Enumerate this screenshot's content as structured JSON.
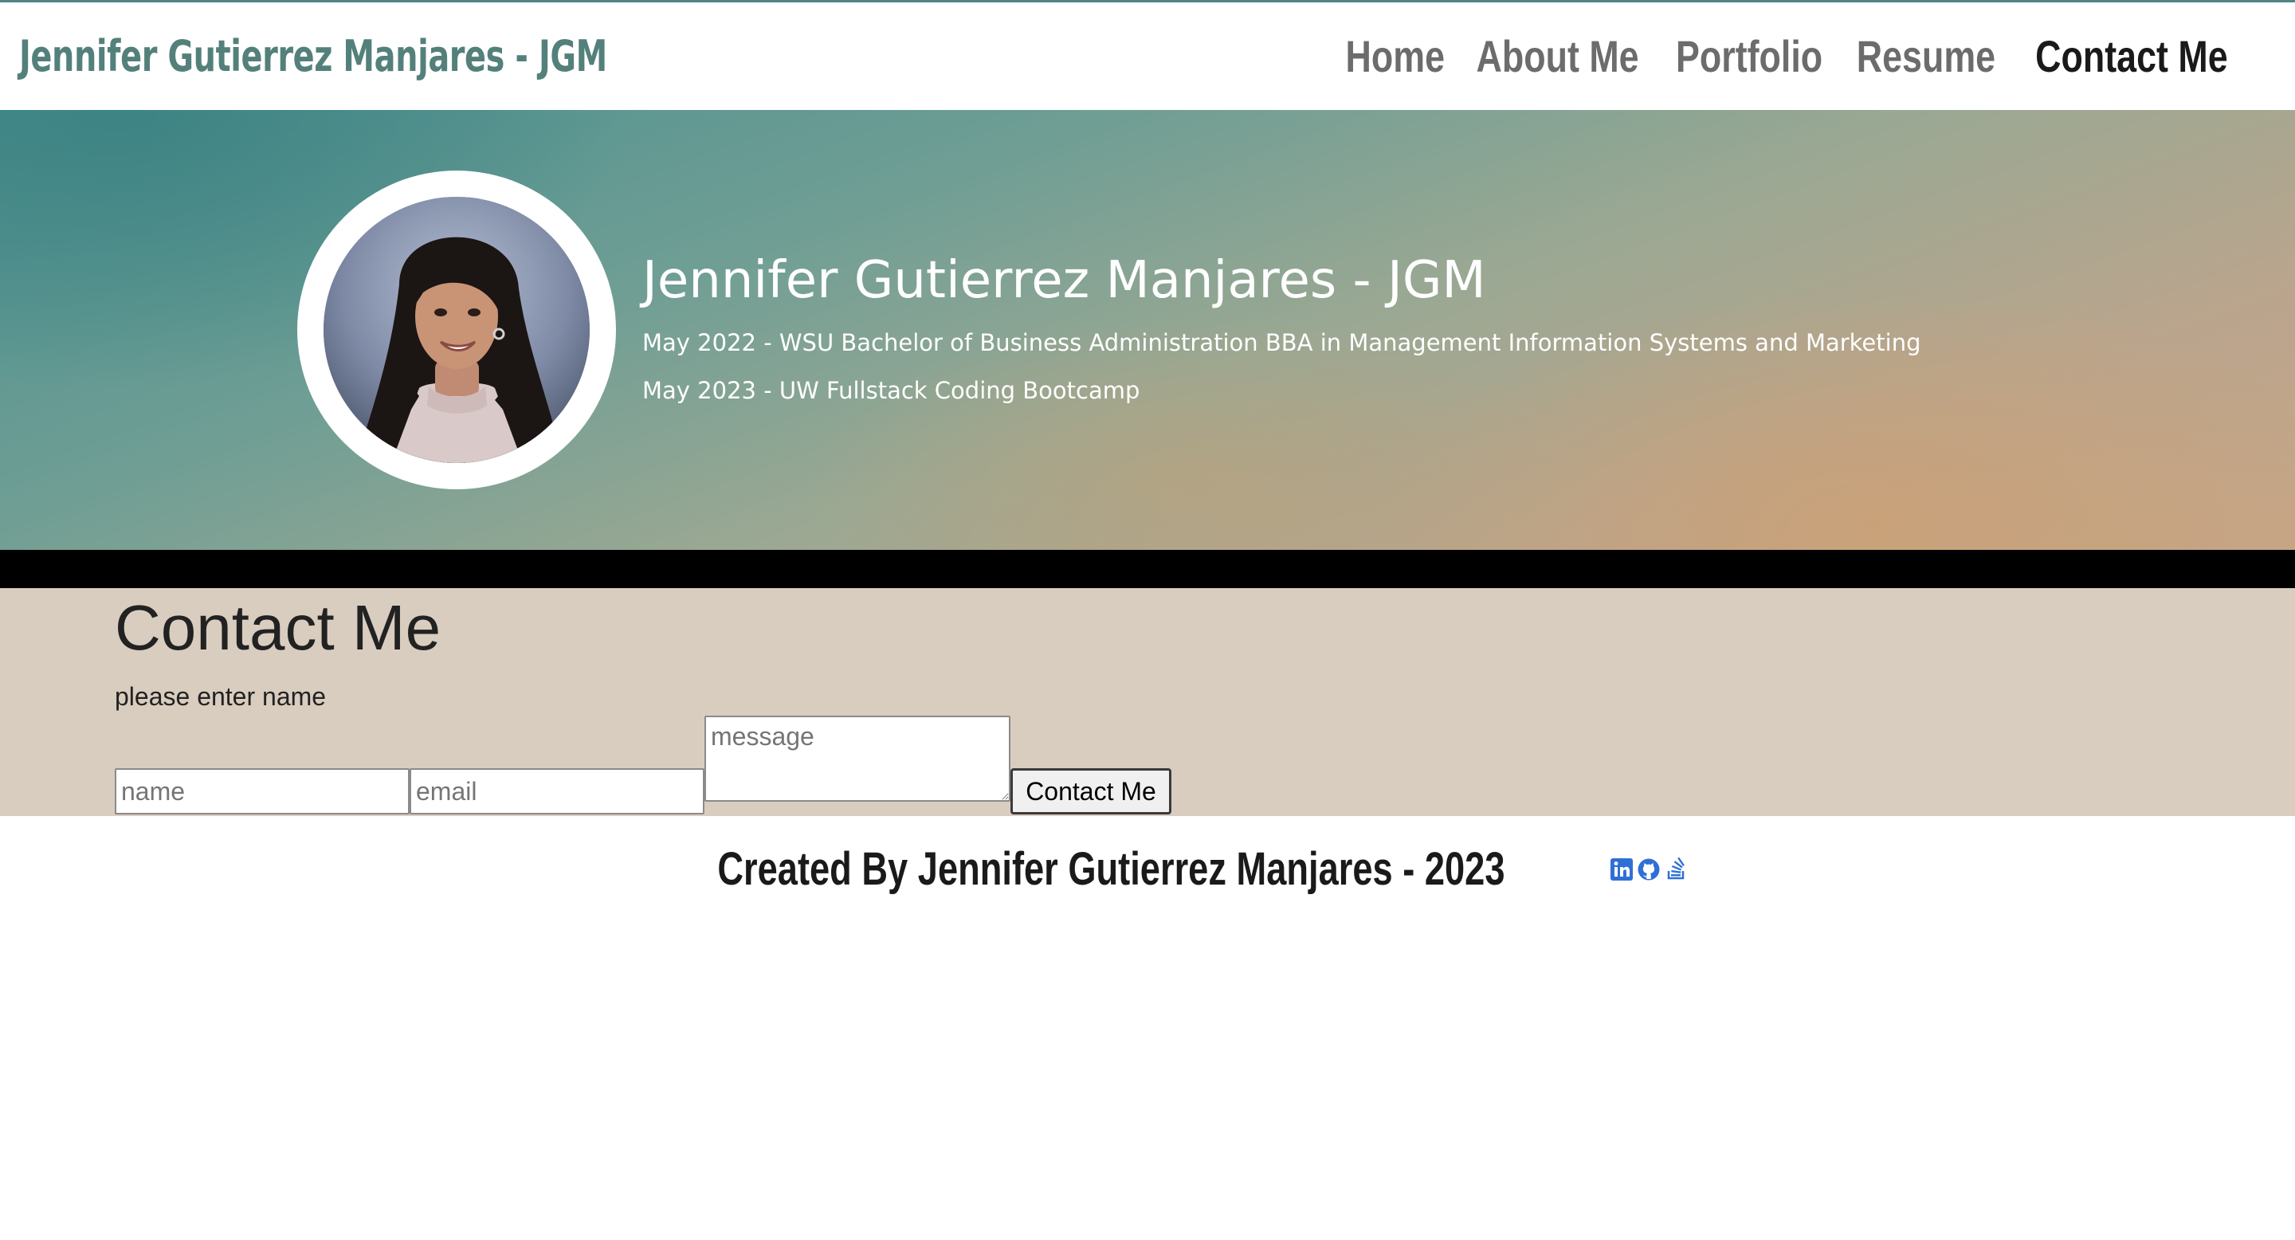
{
  "header": {
    "brand": "Jennifer Gutierrez Manjares - JGM",
    "nav": [
      {
        "label": "Home"
      },
      {
        "label": "About Me"
      },
      {
        "label": "Portfolio"
      },
      {
        "label": "Resume"
      },
      {
        "label": "Contact Me"
      }
    ],
    "active_nav": "Contact Me"
  },
  "hero": {
    "title": "Jennifer Gutierrez Manjares - JGM",
    "lines": [
      "May 2022 - WSU Bachelor of Business Administration BBA in Management Information Systems and Marketing",
      "May 2023 - UW Fullstack Coding Bootcamp"
    ]
  },
  "contact": {
    "title": "Contact Me",
    "hint": "please enter name",
    "name_placeholder": "name",
    "email_placeholder": "email",
    "message_placeholder": "message",
    "submit_label": "Contact Me"
  },
  "footer": {
    "text": "Created By Jennifer Gutierrez Manjares - 2023",
    "socials": [
      "linkedin-icon",
      "github-icon",
      "stackoverflow-icon"
    ]
  },
  "colors": {
    "brand": "#54807b",
    "nav_inactive": "#6c6c6c",
    "nav_active": "#1a1a1a",
    "contact_bg": "#d9cdbf",
    "social_icon": "#2f6fd6"
  }
}
